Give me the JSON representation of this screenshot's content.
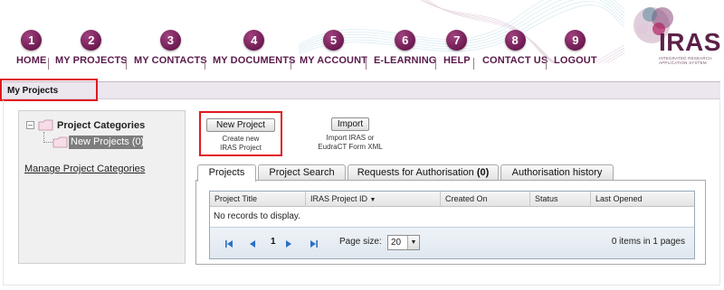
{
  "brand": {
    "logo_text": "IRAS",
    "logo_subtitle": "Integrated Research Application System",
    "colors": {
      "brand_purple": "#6f1a52",
      "highlight_red": "#e0191f"
    }
  },
  "nav": {
    "items": [
      {
        "num": "1",
        "label": "HOME"
      },
      {
        "num": "2",
        "label": "MY PROJECTS"
      },
      {
        "num": "3",
        "label": "MY CONTACTS"
      },
      {
        "num": "4",
        "label": "MY DOCUMENTS"
      },
      {
        "num": "5",
        "label": "MY ACCOUNT"
      },
      {
        "num": "6",
        "label": "E-LEARNING"
      },
      {
        "num": "7",
        "label": "HELP"
      },
      {
        "num": "8",
        "label": "CONTACT US"
      },
      {
        "num": "9",
        "label": "LOGOUT"
      }
    ]
  },
  "page": {
    "title": "My Projects"
  },
  "tree": {
    "root_label": "Project Categories",
    "selected_child": "New Projects (0)",
    "manage_link": "Manage Project Categories",
    "icons": [
      "tree-collapse-icon",
      "folder-icon"
    ]
  },
  "actions": {
    "new_project": {
      "label": "New Project",
      "caption_line1": "Create new",
      "caption_line2": "IRAS Project"
    },
    "import": {
      "label": "Import",
      "caption_line1": "Import IRAS or",
      "caption_line2": "EudraCT Form XML"
    }
  },
  "tabs": {
    "projects": "Projects",
    "project_search": "Project Search",
    "requests_label": "Requests for Authorisation",
    "requests_count": "(0)",
    "authorisation_history": "Authorisation history",
    "active": "Projects"
  },
  "grid": {
    "columns": [
      "Project Title",
      "IRAS Project ID",
      "Created On",
      "Status",
      "Last Opened"
    ],
    "sorted_column": "IRAS Project ID",
    "sort_icon": "sort-down-icon",
    "empty_message": "No records to display.",
    "pager": {
      "current_page": "1",
      "page_size_label": "Page size:",
      "page_size_value": "20",
      "info": "0 items in 1 pages",
      "icons": [
        "first-page-icon",
        "prev-page-icon",
        "next-page-icon",
        "last-page-icon"
      ]
    }
  }
}
